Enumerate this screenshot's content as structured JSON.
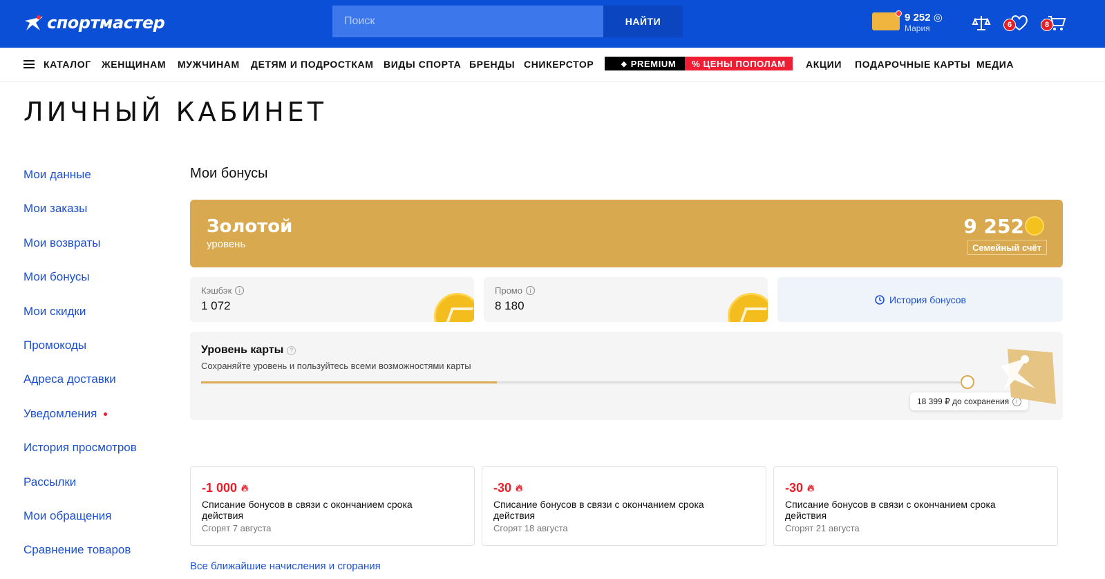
{
  "header": {
    "logo_text": "спортмастер",
    "search_placeholder": "Поиск",
    "search_button": "НАЙТИ",
    "bonus_balance": "9 252 ◎",
    "user_name": "Мария",
    "wishlist_count": "6",
    "cart_count": "8"
  },
  "nav": {
    "items": [
      "КАТАЛОГ",
      "ЖЕНЩИНАМ",
      "МУЖЧИНАМ",
      "ДЕТЯМ И ПОДРОСТКАМ",
      "ВИДЫ СПОРТА",
      "БРЕНДЫ",
      "СНИКЕРСТОР"
    ],
    "premium": "PREMIUM",
    "sale": "% ЦЕНЫ ПОПОЛАМ",
    "items_after": [
      "АКЦИИ",
      "ПОДАРОЧНЫЕ КАРТЫ",
      "МЕДИА"
    ]
  },
  "page_title": "ЛИЧНЫЙ КАБИНЕТ",
  "sidebar": {
    "items": [
      "Мои данные",
      "Мои заказы",
      "Мои возвраты",
      "Мои бонусы",
      "Мои скидки",
      "Промокоды",
      "Адреса доставки",
      "Уведомления",
      "История просмотров",
      "Рассылки",
      "Мои обращения",
      "Сравнение товаров"
    ]
  },
  "bonuses": {
    "title": "Мои бонусы",
    "level_name": "Золотой",
    "level_sub": "уровень",
    "total": "9 252",
    "family_account": "Семейный счёт",
    "cashback_label": "Кэшбэк",
    "cashback_value": "1 072",
    "promo_label": "Промо",
    "promo_value": "8 180",
    "history": "История бонусов"
  },
  "card_level": {
    "title": "Уровень карты",
    "subtitle": "Сохраняйте уровень и пользуйтесь всеми возможностями карты",
    "progress_fraction": 0.39,
    "tip": "18 399 ₽ до сохранения"
  },
  "expiry": [
    {
      "amount": "-1 000",
      "desc": "Списание бонусов в связи с окончанием срока действия",
      "date": "Сгорят 7 августа"
    },
    {
      "amount": "-30",
      "desc": "Списание бонусов в связи с окончанием срока действия",
      "date": "Сгорят 18 августа"
    },
    {
      "amount": "-30",
      "desc": "Списание бонусов в связи с окончанием срока действия",
      "date": "Сгорят 21 августа"
    }
  ],
  "all_link": "Все ближайшие начисления и сгорания",
  "colors": {
    "brand_blue": "#0a4fd6",
    "gold": "#d9a94f",
    "link_blue": "#1b4fd1",
    "red": "#e61e28"
  }
}
